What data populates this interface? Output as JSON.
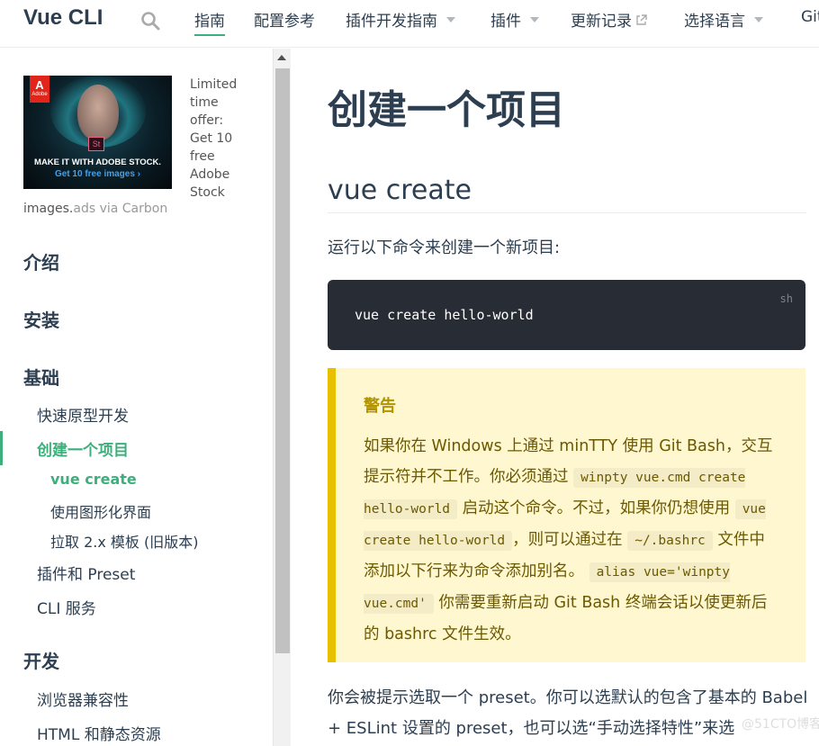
{
  "navbar": {
    "logo": "Vue CLI",
    "items": [
      {
        "label": "指南",
        "active": true
      },
      {
        "label": "配置参考"
      },
      {
        "label": "插件开发指南"
      },
      {
        "label": "插件"
      },
      {
        "label": "更新记录"
      },
      {
        "label": "选择语言"
      },
      {
        "label": "Git"
      }
    ]
  },
  "ad": {
    "image_headline": "MAKE IT WITH ADOBE STOCK.",
    "image_sub": "Get 10 free images ›",
    "adobe_label": "Adobe",
    "st_label": "St",
    "text": "Limited time offer: Get 10 free Adobe Stock",
    "via_prefix": "images.",
    "via_suffix": "ads via Carbon"
  },
  "sidebar": {
    "groups": [
      "介绍",
      "安装",
      "基础",
      "开发"
    ],
    "links": {
      "quick_prototype": "快速原型开发",
      "create_project": "创建一个项目",
      "vue_create": "vue create",
      "gui": "使用图形化界面",
      "pull_legacy": "拉取 2.x 模板 (旧版本)",
      "plugins_preset": "插件和 Preset",
      "cli_service": "CLI 服务",
      "browser_compat": "浏览器兼容性",
      "html_static": "HTML 和静态资源"
    }
  },
  "content": {
    "title": "创建一个项目",
    "section": "vue create",
    "intro": "运行以下命令来创建一个新项目:",
    "code": {
      "lang": "sh",
      "text": "vue create hello-world"
    },
    "warning": {
      "title": "警告",
      "t1": "如果你在 Windows 上通过 minTTY 使用 Git Bash，交互提示符并不工作。你必须通过",
      "c1": "winpty vue.cmd create hello-world",
      "t2": "启动这个命令。不过，如果你仍想使用",
      "c2": "vue create hello-world",
      "t3": "，则可以通过在",
      "c3": "~/.bashrc",
      "t4": "文件中添加以下行来为命令添加别名。",
      "c4": "alias vue='winpty vue.cmd'",
      "t5": "你需要重新启动 Git Bash 终端会话以使更新后的 bashrc 文件生效。"
    },
    "para2": "你会被提示选取一个 preset。你可以选默认的包含了基本的 Babel + ESLint 设置的 preset，也可以选“手动选择特性”来选",
    "watermark": "@51CTO博客"
  }
}
